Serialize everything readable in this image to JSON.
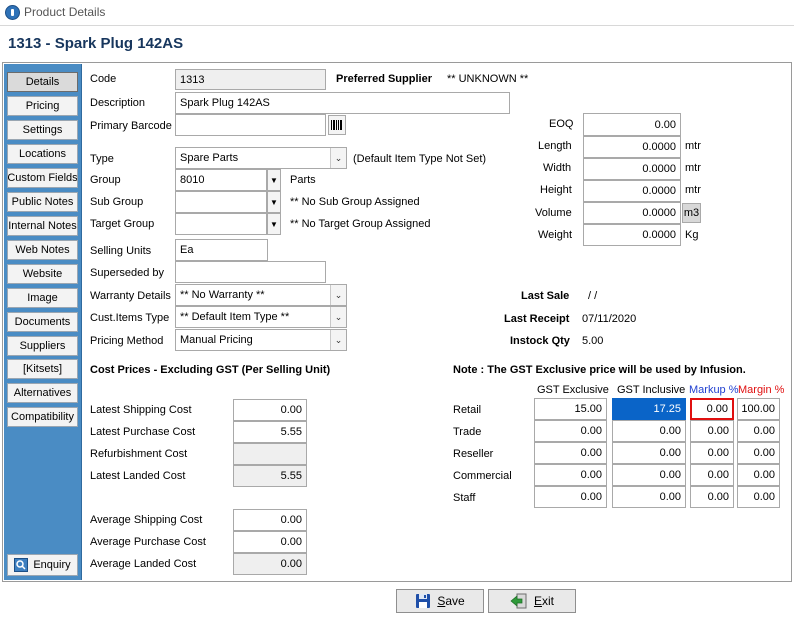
{
  "window": {
    "title": "Product Details"
  },
  "header": {
    "title": "1313 - Spark Plug 142AS"
  },
  "sidebar": {
    "items": [
      {
        "label": "Details"
      },
      {
        "label": "Pricing"
      },
      {
        "label": "Settings"
      },
      {
        "label": "Locations"
      },
      {
        "label": "Custom Fields"
      },
      {
        "label": "Public Notes"
      },
      {
        "label": "Internal Notes"
      },
      {
        "label": "Web Notes"
      },
      {
        "label": "Website"
      },
      {
        "label": "Image"
      },
      {
        "label": "Documents"
      },
      {
        "label": "Suppliers"
      },
      {
        "label": "[Kitsets]"
      },
      {
        "label": "Alternatives"
      },
      {
        "label": "Compatibility"
      }
    ],
    "enquiry_label": "Enquiry"
  },
  "form": {
    "code_label": "Code",
    "code_value": "1313",
    "preferred_supplier_label": "Preferred Supplier",
    "preferred_supplier_value": "** UNKNOWN **",
    "description_label": "Description",
    "description_value": "Spark Plug 142AS",
    "primary_barcode_label": "Primary Barcode",
    "primary_barcode_value": "",
    "type_label": "Type",
    "type_value": "Spare Parts",
    "type_note": "(Default Item Type Not Set)",
    "group_label": "Group",
    "group_value": "8010",
    "group_note": "Parts",
    "sub_group_label": "Sub Group",
    "sub_group_value": "",
    "sub_group_note": "** No Sub Group Assigned",
    "target_group_label": "Target Group",
    "target_group_value": "",
    "target_group_note": "** No Target Group Assigned",
    "selling_units_label": "Selling Units",
    "selling_units_value": "Ea",
    "superseded_by_label": "Superseded by",
    "superseded_by_value": "",
    "warranty_label": "Warranty Details",
    "warranty_value": "** No Warranty **",
    "cust_items_type_label": "Cust.Items Type",
    "cust_items_type_value": "** Default Item Type **",
    "pricing_method_label": "Pricing Method",
    "pricing_method_value": "Manual Pricing"
  },
  "dimensions": {
    "eoq_label": "EOQ",
    "eoq_value": "0.00",
    "length_label": "Length",
    "length_value": "0.0000",
    "length_unit": "mtr",
    "width_label": "Width",
    "width_value": "0.0000",
    "width_unit": "mtr",
    "height_label": "Height",
    "height_value": "0.0000",
    "height_unit": "mtr",
    "volume_label": "Volume",
    "volume_value": "0.0000",
    "volume_unit": "m3",
    "weight_label": "Weight",
    "weight_value": "0.0000",
    "weight_unit": "Kg"
  },
  "sales": {
    "last_sale_label": "Last Sale",
    "last_sale_value": "/ /",
    "last_receipt_label": "Last Receipt",
    "last_receipt_value": "07/11/2020",
    "instock_label": "Instock Qty",
    "instock_value": "5.00"
  },
  "cost": {
    "heading": "Cost Prices - Excluding GST (Per Selling Unit)",
    "rows": [
      {
        "label": "Latest Shipping Cost",
        "value": "0.00"
      },
      {
        "label": "Latest Purchase Cost",
        "value": "5.55"
      },
      {
        "label": "Refurbishment Cost",
        "value": ""
      },
      {
        "label": "Latest Landed Cost",
        "value": "5.55"
      }
    ],
    "avg_rows": [
      {
        "label": "Average Shipping Cost",
        "value": "0.00"
      },
      {
        "label": "Average Purchase Cost",
        "value": "0.00"
      },
      {
        "label": "Average Landed Cost",
        "value": "0.00"
      }
    ]
  },
  "pricing": {
    "note": "Note : The GST Exclusive price will be used by Infusion.",
    "col_gst_excl": "GST Exclusive",
    "col_gst_incl": "GST Inclusive",
    "col_markup": "Markup %",
    "col_margin": "Margin %",
    "markup_color": "#1f3fd0",
    "margin_color": "#e01010",
    "rows": [
      {
        "label": "Retail",
        "excl": "15.00",
        "incl": "17.25",
        "markup": "0.00",
        "margin": "100.00"
      },
      {
        "label": "Trade",
        "excl": "0.00",
        "incl": "0.00",
        "markup": "0.00",
        "margin": "0.00"
      },
      {
        "label": "Reseller",
        "excl": "0.00",
        "incl": "0.00",
        "markup": "0.00",
        "margin": "0.00"
      },
      {
        "label": "Commercial",
        "excl": "0.00",
        "incl": "0.00",
        "markup": "0.00",
        "margin": "0.00"
      },
      {
        "label": "Staff",
        "excl": "0.00",
        "incl": "0.00",
        "markup": "0.00",
        "margin": "0.00"
      }
    ]
  },
  "footer": {
    "save_label_first": "S",
    "save_label_rest": "ave",
    "exit_label_first": "E",
    "exit_label_rest": "xit"
  }
}
